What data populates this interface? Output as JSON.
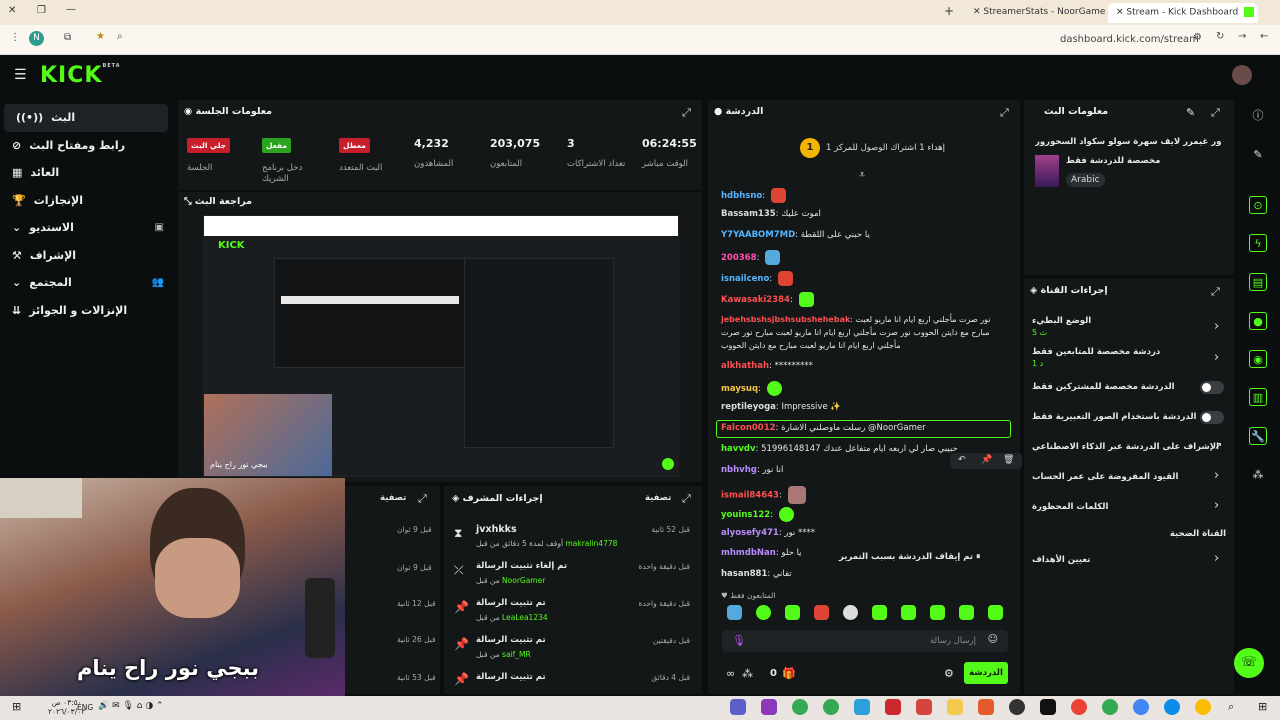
{
  "browser": {
    "tabs": [
      {
        "label": "StreamerStats - NoorGamer Str"
      },
      {
        "label": "Stream - Kick Dashboard"
      }
    ],
    "address": "dashboard.kick.com/stream",
    "profile_initial": "N"
  },
  "kick": {
    "logo": "KICK",
    "logo_sup": "BETA"
  },
  "nav": {
    "items": [
      {
        "label": "البث",
        "icon": "stream-icon"
      },
      {
        "label": "رابط ومفتاح البث",
        "icon": "link-icon"
      },
      {
        "label": "العائد",
        "icon": "revenue-icon"
      },
      {
        "label": "الإنجازات",
        "icon": "trophy-icon"
      },
      {
        "label": "الاستديو",
        "icon": "studio-icon"
      },
      {
        "label": "الإشراف",
        "icon": "moderation-icon"
      },
      {
        "label": "المجتمع",
        "icon": "community-icon"
      },
      {
        "label": "الإنزالات و الجوائز",
        "icon": "drops-icon"
      }
    ]
  },
  "session": {
    "title": "معلومات الجلسة",
    "stats": [
      {
        "value": "06:24:55",
        "label": "الوقت مباشر"
      },
      {
        "value": "3",
        "label": "تعداد الاشتراكات"
      },
      {
        "value": "203,075",
        "label": "المتابعون"
      },
      {
        "value": "4,232",
        "label": "المشاهدون"
      }
    ],
    "badges": [
      {
        "text": "معطل",
        "label": "البث المتعدد",
        "color": "#c81e2b"
      },
      {
        "text": "مفعل",
        "label": "دخل برنامج الشريك",
        "color": "#2aa31e"
      },
      {
        "text": "جلي البث",
        "label": "الجلسة",
        "color": "#c81e2b"
      }
    ]
  },
  "preview": {
    "title": "مراجعة البث",
    "overlay_caption": "ببجي نور راح ينام"
  },
  "chat": {
    "title": "الدردشة",
    "pinned": "إهداء 1 اشتراك الوصول للمركز 1",
    "messages": [
      {
        "user": "hdbhsno",
        "color": "#55b6ff",
        "text": ""
      },
      {
        "user": "Bassam135",
        "color": "#ddd",
        "text": "اموت عليك"
      },
      {
        "user": "Y7YAABOM7MD",
        "color": "#55b6ff",
        "text": "يا حبني على اللقطة"
      },
      {
        "user": "200368",
        "color": "#ff4fb1",
        "text": ""
      },
      {
        "user": "isnailceno",
        "color": "#55b6ff",
        "text": ""
      },
      {
        "user": "Kawasaki2384",
        "color": "#ff4f4f",
        "text": ""
      },
      {
        "user": "jebehsbshsjbshsubshehebak",
        "color": "#ff4f4f",
        "text": "نور صرت مأجلني اربع ايام انا ماريو لعبت مبارح"
      },
      {
        "user": "",
        "color": "#ddd",
        "text": "مع دايتن الحووب نور صرت مأجلني اربع ايام انا ماريو لعبت مبارح"
      },
      {
        "user": "",
        "color": "#ddd",
        "text": "نور صرت مأجلني اربع ايام انا ماريو لعبت مبارح مع دايتن الحووب"
      },
      {
        "user": "alkhathah",
        "color": "#ff4f4f",
        "text": "*********"
      },
      {
        "user": "maysuq",
        "color": "#f5c542",
        "text": ""
      },
      {
        "user": "reptileyoga",
        "color": "#ddd",
        "text": "Impressive"
      },
      {
        "user": "Falcon0012",
        "color": "#ff4f4f",
        "text": "رسلت ماوصلني الاشارة @NoorGamer"
      },
      {
        "user": "havvdv",
        "color": "#53fc18",
        "text": "51996148147 حبيبي صار لي اربعه ايام متفاعل عندك"
      },
      {
        "user": "nbhvhg",
        "color": "#b98cff",
        "text": "انا نور"
      },
      {
        "user": "ismail84643",
        "color": "#ff4f4f",
        "text": ""
      },
      {
        "user": "youins122",
        "color": "#53fc18",
        "text": ""
      },
      {
        "user": "alyosefy471",
        "color": "#b98cff",
        "text": "نور ****"
      },
      {
        "user": "mhmdbNan",
        "color": "#b98cff",
        "text": "يا حلو"
      },
      {
        "user": "hasan881",
        "color": "#ddd",
        "text": "تفاني"
      }
    ],
    "paused": "تم إيقاف الدردشة بسبب التمرير",
    "followers_only": "المتابعون فقط",
    "input_placeholder": "إرسال رسالة",
    "send_label": "الدردشة",
    "viewer_count": "0"
  },
  "stream_info": {
    "title": "معلومات البث",
    "stream_title": "النور غيمرر لايف سهرة سولو سكواد السحورور",
    "subtitle": "مخصصة للدردشة فقط",
    "tag": "Arabic"
  },
  "channel_actions": {
    "title": "إجراءات القناة",
    "items": [
      {
        "label": "الوضع البطيء",
        "sub": "5 ث",
        "control": "chevron"
      },
      {
        "label": "دردشة مخصصة للمتابعين فقط",
        "sub": "1 د",
        "control": "chevron"
      },
      {
        "label": "الدردشة مخصصة للمشتركين فقط",
        "sub": "",
        "control": "toggle"
      },
      {
        "label": "الدردشة باستخدام الصور التعبيرية فقط",
        "sub": "",
        "control": "toggle"
      },
      {
        "label": "الإشراف على الدردشة عبر الذكاء الاصطناعي",
        "sub": "",
        "control": "external"
      },
      {
        "label": "القيود المفروضة على عمر الحساب",
        "sub": "",
        "control": "chevron"
      },
      {
        "label": "الكلمات المحظورة",
        "sub": "",
        "control": "chevron"
      },
      {
        "label": "القناة الضحية",
        "sub": "",
        "control": "none"
      },
      {
        "label": "تعيين الأهداف",
        "sub": "",
        "control": "chevron"
      }
    ]
  },
  "mod_actions": {
    "title": "إجراءات المشرف",
    "filter": "تصفية",
    "rows": [
      {
        "title": "jvxhkks",
        "detail": "أوقف لمدة 5 دقائق من قبل",
        "who": "makralin4778",
        "time": "قبل 52 ثانية",
        "icon": "timeout-icon"
      },
      {
        "title": "تم إلغاء تثبيت الرسالة",
        "detail": "من قبل",
        "who": "NoorGamer",
        "time": "قبل دقيقة واحدة",
        "icon": "unpin-icon"
      },
      {
        "title": "تم تثبيت الرسالة",
        "detail": "من قبل",
        "who": "LeaLea1234",
        "time": "قبل دقيقة واحدة",
        "icon": "pin-icon"
      },
      {
        "title": "تم تثبيت الرسالة",
        "detail": "من قبل",
        "who": "saif_MR",
        "time": "قبل دقيقتين",
        "icon": "pin-icon"
      },
      {
        "title": "تم تثبيت الرسالة",
        "detail": "",
        "who": "",
        "time": "قبل 4 دقائق",
        "icon": "pin-icon"
      }
    ]
  },
  "activity": {
    "filter": "تصفية",
    "times": [
      "قبل 9 ثوان",
      "قبل 9 ثوان",
      "قبل 12 ثانية",
      "قبل 26 ثانية",
      "قبل 53 ثانية"
    ]
  },
  "webcam_caption": "ببجي نور راح ينام",
  "taskbar": {
    "time": "٠٣:٥٠ ص",
    "date": "٢٠٢٦/٠٣/٠٢",
    "lang": "ENG"
  }
}
